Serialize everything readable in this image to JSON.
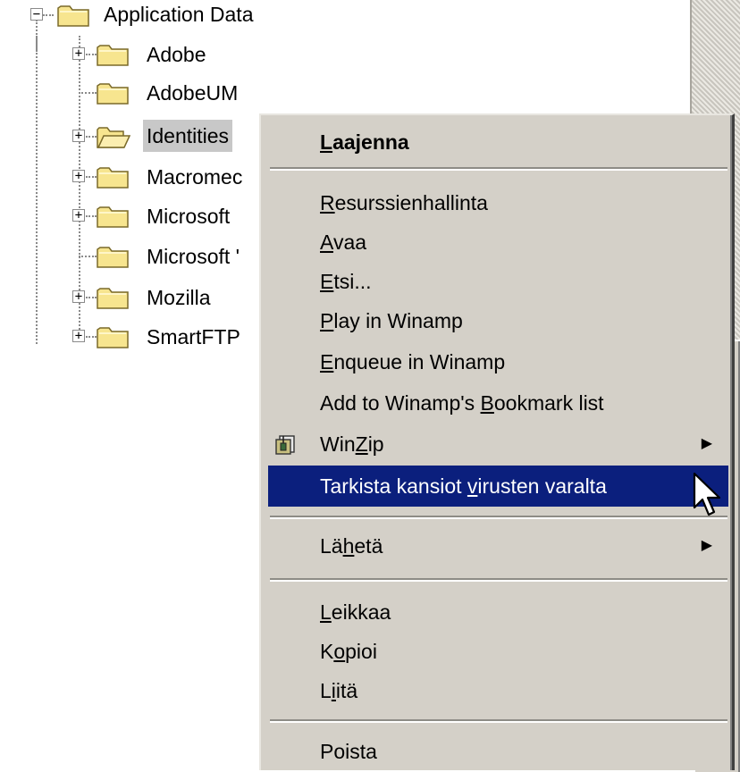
{
  "tree": {
    "root": {
      "label": "Application Data",
      "expander": "−"
    },
    "items": [
      {
        "label": "Adobe",
        "expander": "+"
      },
      {
        "label": "AdobeUM",
        "expander": ""
      },
      {
        "label": "Identities",
        "expander": "+",
        "selected": true,
        "open_folder": true
      },
      {
        "label": "Macromec",
        "expander": "+"
      },
      {
        "label": "Microsoft",
        "expander": "+"
      },
      {
        "label": "Microsoft '",
        "expander": ""
      },
      {
        "label": "Mozilla",
        "expander": "+"
      },
      {
        "label": "SmartFTP",
        "expander": "+"
      }
    ]
  },
  "menu": {
    "items": [
      {
        "pre": "",
        "key": "L",
        "post": "aajenna",
        "bold": true
      },
      {
        "pre": "",
        "key": "R",
        "post": "esurssienhallinta"
      },
      {
        "pre": "",
        "key": "A",
        "post": "vaa"
      },
      {
        "pre": "",
        "key": "E",
        "post": "tsi..."
      },
      {
        "pre": "",
        "key": "P",
        "post": "lay in Winamp"
      },
      {
        "pre": "",
        "key": "E",
        "post": "nqueue in Winamp"
      },
      {
        "pre": "Add to Winamp's ",
        "key": "B",
        "post": "ookmark list"
      },
      {
        "pre": "Win",
        "key": "Z",
        "post": "ip",
        "submenu": "▶",
        "icon": "winzip-icon"
      },
      {
        "pre": "Tarkista kansiot ",
        "key": "v",
        "post": "irusten varalta",
        "highlighted": true
      },
      {
        "pre": "Lä",
        "key": "h",
        "post": "etä",
        "submenu": "▶"
      },
      {
        "pre": "",
        "key": "L",
        "post": "eikkaa"
      },
      {
        "pre": "K",
        "key": "o",
        "post": "pioi"
      },
      {
        "pre": "L",
        "key": "i",
        "post": "itä"
      },
      {
        "pre": "Poista",
        "key": "",
        "post": ""
      }
    ]
  },
  "colors": {
    "menu_bg": "#d4d0c8",
    "highlight_bg": "#0b1f7d",
    "highlight_fg": "#ffffff",
    "selection_bg": "#c8c8c8",
    "folder_yellow": "#f7e58f"
  },
  "icons": {
    "folder": "folder-icon",
    "folder_open": "folder-open-icon",
    "winzip": "winzip-icon",
    "cursor": "mouse-pointer-icon"
  }
}
